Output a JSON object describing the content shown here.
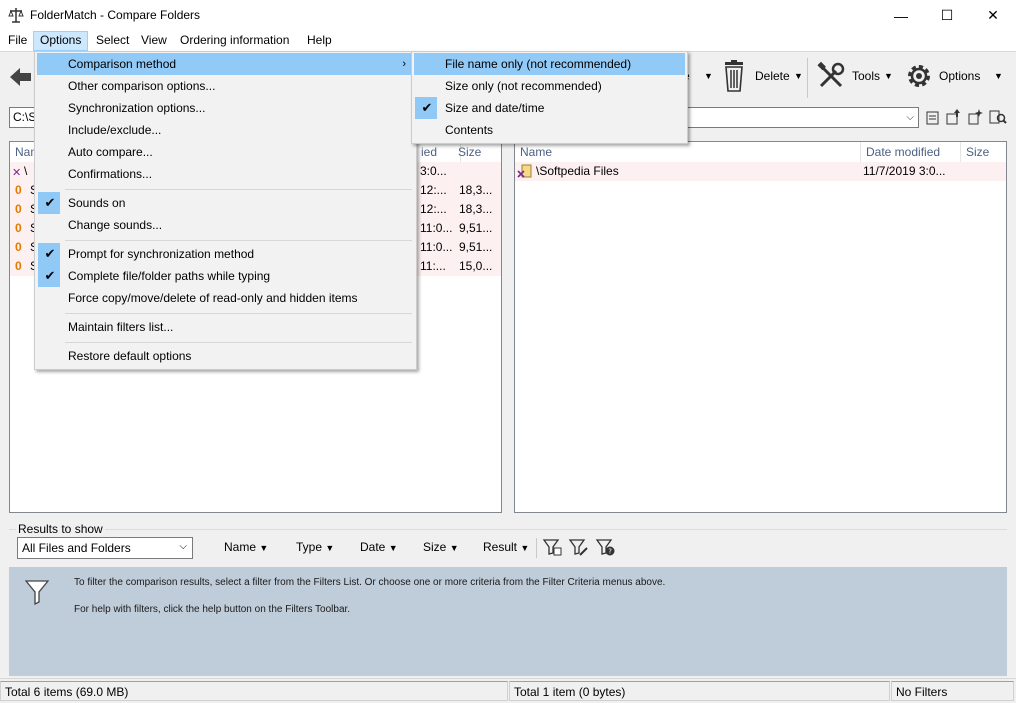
{
  "window": {
    "title": "FolderMatch - Compare Folders",
    "minimize": "—",
    "maximize": "☐",
    "close": "✕"
  },
  "menubar": [
    {
      "label": "File"
    },
    {
      "label": "Options"
    },
    {
      "label": "Select"
    },
    {
      "label": "View"
    },
    {
      "label": "Ordering information"
    },
    {
      "label": "Help"
    }
  ],
  "toolbar": {
    "delete_label": "Delete",
    "tools_label": "Tools",
    "options_label": "Options",
    "partial_label": "e"
  },
  "left_path": "C:\\S",
  "left_pane": {
    "header": {
      "name": "Nam",
      "modified": "ied",
      "size": "Size"
    },
    "rows": [
      {
        "prefix": "\\",
        "date": "3:0...",
        "size": ""
      },
      {
        "prefix": "S",
        "date": "12:...",
        "size": "18,3..."
      },
      {
        "prefix": "S",
        "date": "12:...",
        "size": "18,3..."
      },
      {
        "prefix": "S",
        "date": "11:0...",
        "size": "9,51..."
      },
      {
        "prefix": "S",
        "date": "11:0...",
        "size": "9,51..."
      },
      {
        "prefix": "S",
        "date": "11:...",
        "size": "15,0..."
      }
    ]
  },
  "right_pane": {
    "header": {
      "name": "Name",
      "modified": "Date modified",
      "size": "Size"
    },
    "rows": [
      {
        "name": "\\Softpedia Files",
        "date": "11/7/2019 3:0...",
        "size": ""
      }
    ]
  },
  "results": {
    "label": "Results to show",
    "select_value": "All Files and Folders",
    "criteria": [
      "Name",
      "Type",
      "Date",
      "Size",
      "Result"
    ],
    "info_line1": "To filter the comparison results, select a filter from the Filters List. Or choose one or more criteria from the Filter Criteria menus above.",
    "info_line2": "For help with filters, click the help button on the Filters Toolbar."
  },
  "status": {
    "left": "Total 6 items (69.0 MB)",
    "right": "Total 1 item (0 bytes)",
    "filters": "No Filters"
  },
  "options_menu": {
    "items": [
      {
        "label": "Comparison method",
        "checked": false,
        "submenu": true
      },
      {
        "label": "Other comparison options...",
        "checked": false
      },
      {
        "label": "Synchronization options...",
        "checked": false
      },
      {
        "label": "Include/exclude...",
        "checked": false
      },
      {
        "label": "Auto compare...",
        "checked": false
      },
      {
        "label": "Confirmations...",
        "checked": false
      },
      {
        "label": "Sounds on",
        "checked": true
      },
      {
        "label": "Change sounds...",
        "checked": false
      },
      {
        "label": "Prompt for synchronization method",
        "checked": true
      },
      {
        "label": "Complete file/folder paths while typing",
        "checked": true
      },
      {
        "label": "Force copy/move/delete of read-only and hidden items",
        "checked": false
      },
      {
        "label": "Maintain filters list...",
        "checked": false
      },
      {
        "label": "Restore default options",
        "checked": false
      }
    ]
  },
  "comparison_submenu": {
    "items": [
      {
        "label": "File name only (not recommended)",
        "checked": false
      },
      {
        "label": "Size only (not recommended)",
        "checked": false
      },
      {
        "label": "Size and date/time",
        "checked": true
      },
      {
        "label": "Contents",
        "checked": false
      }
    ]
  },
  "colors": {
    "accent": "#91c9f7",
    "info_bg": "#bfccd9",
    "row_pink": "#fdf0f0"
  }
}
